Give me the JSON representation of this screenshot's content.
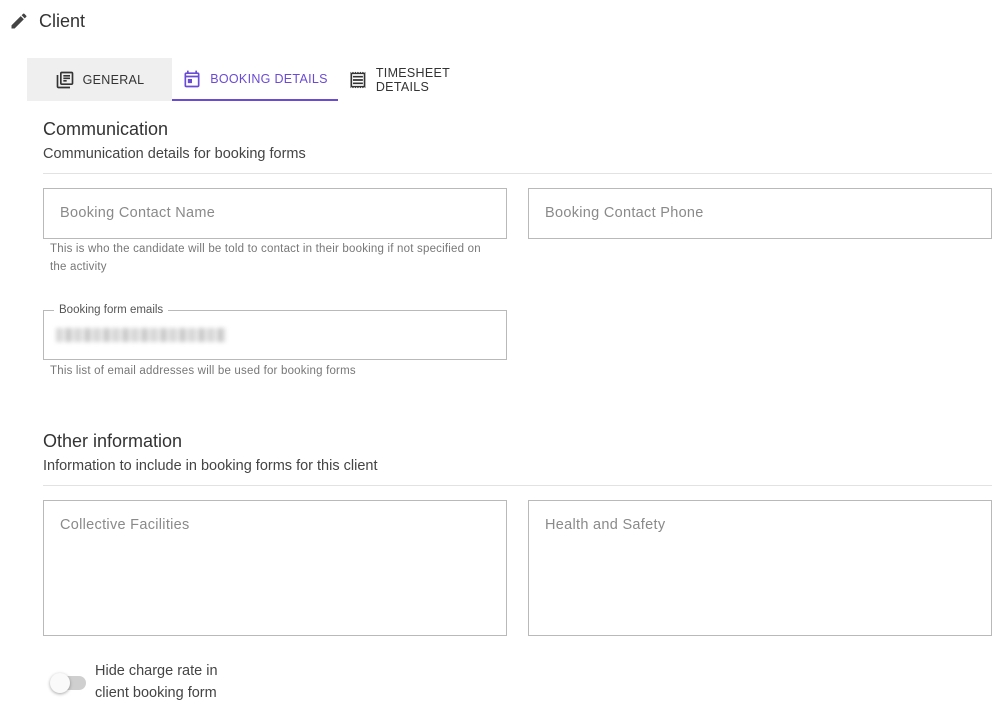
{
  "header": {
    "title": "Client",
    "icon": "pencil-icon"
  },
  "tabs": [
    {
      "label": "GENERAL",
      "icon": "library-books-icon",
      "active": false
    },
    {
      "label": "BOOKING DETAILS",
      "icon": "calendar-icon",
      "active": true
    },
    {
      "label": "TIMESHEET DETAILS",
      "icon": "receipt-icon",
      "active": false
    }
  ],
  "colors": {
    "accent": "#6a4bd6",
    "inactive_tab_bg": "#efefef"
  },
  "communication": {
    "title": "Communication",
    "subtitle": "Communication details for booking forms",
    "contact_name": {
      "placeholder": "Booking Contact Name",
      "value": "",
      "helper": "This is who the candidate will be told to contact in their booking if not specified on the activity"
    },
    "contact_phone": {
      "placeholder": "Booking Contact Phone",
      "value": ""
    },
    "emails": {
      "label": "Booking form emails",
      "helper": "This list of email addresses will be used for booking forms"
    }
  },
  "other": {
    "title": "Other information",
    "subtitle": "Information to include in booking forms for this client",
    "facilities": {
      "placeholder": "Collective Facilities",
      "value": ""
    },
    "health_safety": {
      "placeholder": "Health and Safety",
      "value": ""
    }
  },
  "toggle": {
    "label": "Hide charge rate in client booking form",
    "on": false
  }
}
